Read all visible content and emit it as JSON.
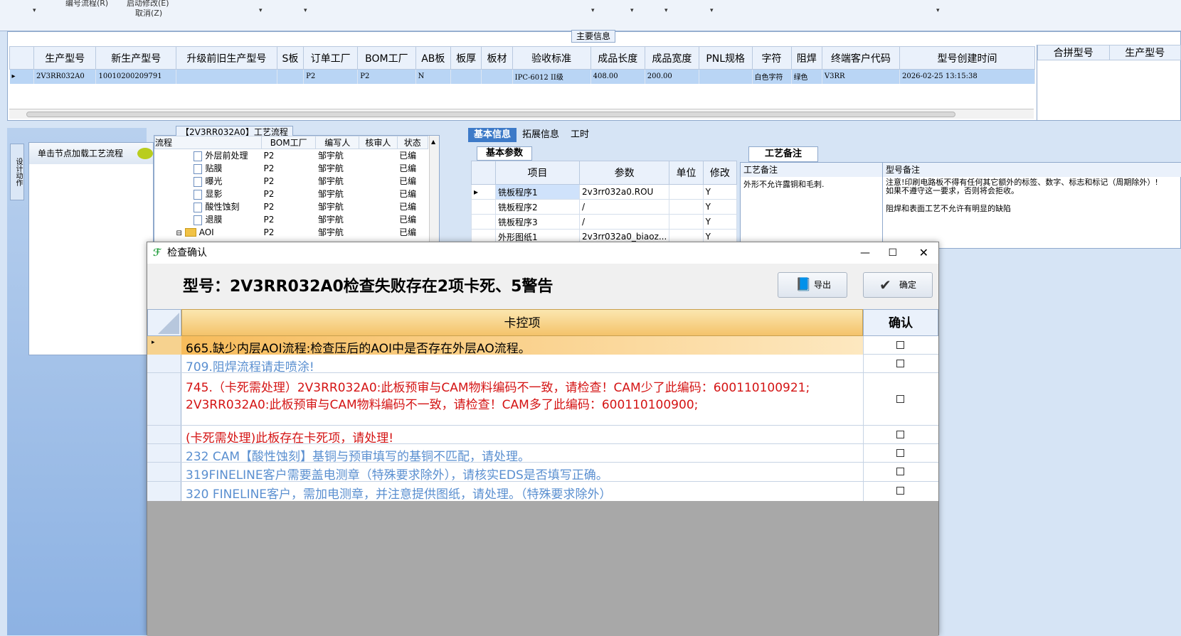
{
  "toolbar": {
    "menu1": "编号流程(R)",
    "menu2": "启动修改(E)",
    "menu3": "取消(Z)"
  },
  "main": {
    "section_title": "主要信息",
    "columns": [
      "生产型号",
      "新生产型号",
      "升级前旧生产型号",
      "S板",
      "订单工厂",
      "BOM工厂",
      "AB板",
      "板厚",
      "板材",
      "验收标准",
      "成品长度",
      "成品宽度",
      "PNL规格",
      "字符",
      "阻焊",
      "终端客户代码",
      "型号创建时间"
    ],
    "row": [
      "2V3RR032A0",
      "10010200209791",
      "",
      "",
      "P2",
      "P2",
      "N",
      "",
      "",
      "IPC-6012 II级",
      "408.00",
      "200.00",
      "",
      "白色字符",
      "绿色",
      "V3RR",
      "2026-02-25 13:15:38"
    ],
    "merge_columns": [
      "合拼型号",
      "生产型号"
    ]
  },
  "left": {
    "side_tab": "设计动作",
    "node_hint": "单击节点加载工艺流程"
  },
  "flow": {
    "title": "【2V3RR032A0】工艺流程",
    "columns": [
      "流程",
      "BOM工厂",
      "编写人",
      "核审人",
      "状态"
    ],
    "rows": [
      {
        "name": "外层前处理",
        "bom": "P2",
        "writer": "邹宇航",
        "reviewer": "",
        "status": "已编"
      },
      {
        "name": "贴膜",
        "bom": "P2",
        "writer": "邹宇航",
        "reviewer": "",
        "status": "已编"
      },
      {
        "name": "曝光",
        "bom": "P2",
        "writer": "邹宇航",
        "reviewer": "",
        "status": "已编"
      },
      {
        "name": "显影",
        "bom": "P2",
        "writer": "邹宇航",
        "reviewer": "",
        "status": "已编"
      },
      {
        "name": "酸性蚀刻",
        "bom": "P2",
        "writer": "邹宇航",
        "reviewer": "",
        "status": "已编"
      },
      {
        "name": "退膜",
        "bom": "P2",
        "writer": "邹宇航",
        "reviewer": "",
        "status": "已编"
      },
      {
        "name": "AOI",
        "bom": "P2",
        "writer": "邹宇航",
        "reviewer": "",
        "status": "已编"
      }
    ]
  },
  "info": {
    "tabs": [
      "基本信息",
      "拓展信息",
      "工时"
    ],
    "subtab": "基本参数",
    "columns": [
      "项目",
      "参数",
      "单位",
      "修改"
    ],
    "rows": [
      {
        "item": "铣板程序1",
        "param": "2v3rr032a0.ROU",
        "unit": "",
        "mod": "Y"
      },
      {
        "item": "铣板程序2",
        "param": "/",
        "unit": "",
        "mod": "Y"
      },
      {
        "item": "铣板程序3",
        "param": "/",
        "unit": "",
        "mod": "Y"
      },
      {
        "item": "外形图纸1",
        "param": "2v3rr032a0_biaoz...",
        "unit": "",
        "mod": "Y"
      }
    ]
  },
  "remark": {
    "tab": "工艺备注",
    "col1": "工艺备注",
    "col2": "型号备注",
    "text1": "外形不允许露铜和毛刺.",
    "text2a": "注意!印刷电路板不得有任何其它额外的标签、数字、标志和标记（周期除外）!如果不遵守这一要求，否则将会拒收。",
    "text2b": "阻焊和表面工艺不允许有明显的缺陷"
  },
  "dialog": {
    "title": "检查确认",
    "heading": "型号：2V3RR032A0检查失败存在2项卡死、5警告",
    "export_label": "导出",
    "ok_label": "确定",
    "col_item": "卡控项",
    "col_confirm": "确认",
    "rows": [
      {
        "text": "665.缺少内层AOI流程:检查压后的AOI中是否存在外层AO流程。",
        "color": "#000000"
      },
      {
        "text": "709.阻焊流程请走喷涂!",
        "color": "#5a8fd0"
      },
      {
        "text": "745.（卡死需处理）2V3RR032A0:此板预审与CAM物料编码不一致，请检查！CAM少了此编码：600110100921;",
        "text2": "2V3RR032A0:此板预审与CAM物料编码不一致，请检查！CAM多了此编码：600110100900;",
        "color": "#d41414"
      },
      {
        "text": "(卡死需处理)此板存在卡死项，请处理!",
        "color": "#d41414"
      },
      {
        "text": "232 CAM【酸性蚀刻】基铜与预审填写的基铜不匹配，请处理。",
        "color": "#5a8fd0"
      },
      {
        "text": "319FINELINE客户需要盖电测章（特殊要求除外），请核实EDS是否填写正确。",
        "color": "#5a8fd0"
      },
      {
        "text": "320 FINELINE客户，需加电测章，并注意提供图纸，请处理。（特殊要求除外）",
        "color": "#5a8fd0"
      }
    ]
  }
}
